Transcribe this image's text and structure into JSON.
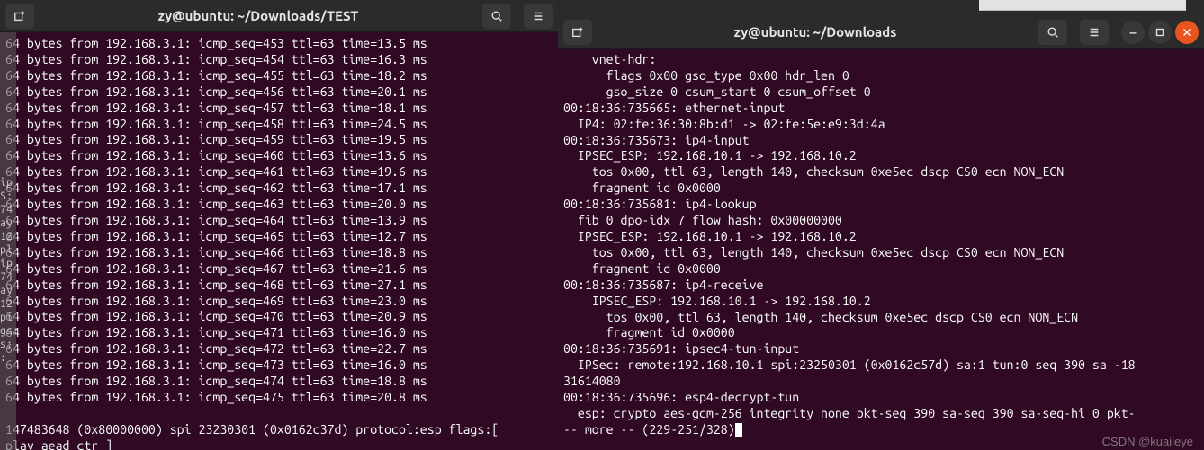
{
  "left": {
    "title": "zy@ubuntu: ~/Downloads/TEST",
    "gutter": "ip\nS:\n74\nay\n12\npl\nip\n74\nay\n12\npl\ngs:\ns:\n:",
    "ping": [
      {
        "seq": 453,
        "ttl": 63,
        "time": "13.5"
      },
      {
        "seq": 454,
        "ttl": 63,
        "time": "16.3"
      },
      {
        "seq": 455,
        "ttl": 63,
        "time": "18.2"
      },
      {
        "seq": 456,
        "ttl": 63,
        "time": "20.1"
      },
      {
        "seq": 457,
        "ttl": 63,
        "time": "18.1"
      },
      {
        "seq": 458,
        "ttl": 63,
        "time": "24.5"
      },
      {
        "seq": 459,
        "ttl": 63,
        "time": "19.5"
      },
      {
        "seq": 460,
        "ttl": 63,
        "time": "13.6"
      },
      {
        "seq": 461,
        "ttl": 63,
        "time": "19.6"
      },
      {
        "seq": 462,
        "ttl": 63,
        "time": "17.1"
      },
      {
        "seq": 463,
        "ttl": 63,
        "time": "20.0"
      },
      {
        "seq": 464,
        "ttl": 63,
        "time": "13.9"
      },
      {
        "seq": 465,
        "ttl": 63,
        "time": "12.7"
      },
      {
        "seq": 466,
        "ttl": 63,
        "time": "18.8"
      },
      {
        "seq": 467,
        "ttl": 63,
        "time": "21.6"
      },
      {
        "seq": 468,
        "ttl": 63,
        "time": "27.1"
      },
      {
        "seq": 469,
        "ttl": 63,
        "time": "23.0"
      },
      {
        "seq": 470,
        "ttl": 63,
        "time": "20.9"
      },
      {
        "seq": 471,
        "ttl": 63,
        "time": "16.0"
      },
      {
        "seq": 472,
        "ttl": 63,
        "time": "22.7"
      },
      {
        "seq": 473,
        "ttl": 63,
        "time": "16.0"
      },
      {
        "seq": 474,
        "ttl": 63,
        "time": "18.8"
      },
      {
        "seq": 475,
        "ttl": 63,
        "time": "20.8"
      }
    ],
    "ping_from": "192.168.3.1",
    "ping_bytes": "64",
    "tail1": "147483648 (0x80000000) spi 23230301 (0x0162c37d) protocol:esp flags:[",
    "tail2": "play aead ctr ]"
  },
  "right": {
    "title": "zy@ubuntu: ~/Downloads",
    "lines": [
      "    vnet-hdr:",
      "      flags 0x00 gso_type 0x00 hdr_len 0",
      "      gso_size 0 csum_start 0 csum_offset 0",
      "00:18:36:735665: ethernet-input",
      "  IP4: 02:fe:36:30:8b:d1 -> 02:fe:5e:e9:3d:4a",
      "00:18:36:735673: ip4-input",
      "  IPSEC_ESP: 192.168.10.1 -> 192.168.10.2",
      "    tos 0x00, ttl 63, length 140, checksum 0xe5ec dscp CS0 ecn NON_ECN",
      "    fragment id 0x0000",
      "00:18:36:735681: ip4-lookup",
      "  fib 0 dpo-idx 7 flow hash: 0x00000000",
      "  IPSEC_ESP: 192.168.10.1 -> 192.168.10.2",
      "    tos 0x00, ttl 63, length 140, checksum 0xe5ec dscp CS0 ecn NON_ECN",
      "    fragment id 0x0000",
      "00:18:36:735687: ip4-receive",
      "    IPSEC_ESP: 192.168.10.1 -> 192.168.10.2",
      "      tos 0x00, ttl 63, length 140, checksum 0xe5ec dscp CS0 ecn NON_ECN",
      "      fragment id 0x0000",
      "00:18:36:735691: ipsec4-tun-input",
      "  IPSec: remote:192.168.10.1 spi:23250301 (0x0162c57d) sa:1 tun:0 seq 390 sa -18",
      "31614080",
      "00:18:36:735696: esp4-decrypt-tun",
      "  esp: crypto aes-gcm-256 integrity none pkt-seq 390 sa-seq 390 sa-seq-hi 0 pkt-"
    ],
    "more": "-- more -- (229-251/328)"
  },
  "watermark": "CSDN @kuaileye"
}
